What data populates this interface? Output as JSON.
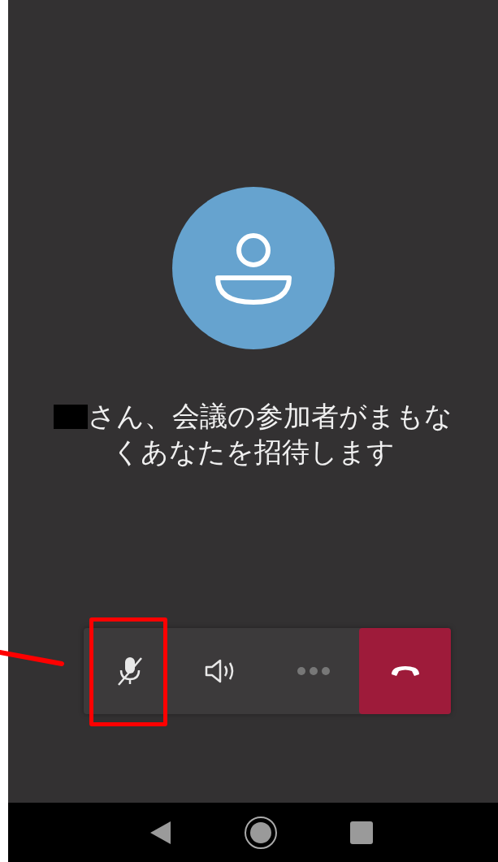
{
  "call": {
    "redacted_name": true,
    "message_lines": [
      "さん、会議の参加者がまもな",
      "くあなたを招待します"
    ]
  },
  "controls": [
    {
      "kind": "mic",
      "muted": true
    },
    {
      "kind": "speaker"
    },
    {
      "kind": "more",
      "disabled": true
    },
    {
      "kind": "hangup"
    }
  ],
  "nav_bar": [
    {
      "kind": "back"
    },
    {
      "kind": "home"
    },
    {
      "kind": "recents"
    }
  ]
}
